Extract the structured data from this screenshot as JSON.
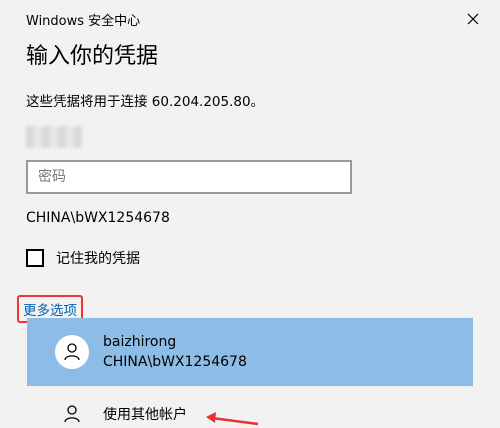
{
  "window": {
    "title": "Windows 安全中心",
    "close_icon": "close-icon"
  },
  "heading": "输入你的凭据",
  "description": "这些凭据将用于连接 60.204.205.80。",
  "password_field": {
    "placeholder": "密码",
    "value": ""
  },
  "domain_user": "CHINA\\bWX1254678",
  "remember": {
    "label": "记住我的凭据",
    "checked": false
  },
  "more_options": {
    "label": "更多选项"
  },
  "accounts": [
    {
      "name": "baizhirong",
      "domain_user": "CHINA\\bWX1254678",
      "selected": true,
      "icon": "person-icon"
    },
    {
      "name": "使用其他帐户",
      "selected": false,
      "icon": "person-icon"
    }
  ],
  "colors": {
    "background": "#f2f2f2",
    "selected_account": "#8dbde6",
    "link": "#0063b1",
    "annotation": "#e33333"
  }
}
